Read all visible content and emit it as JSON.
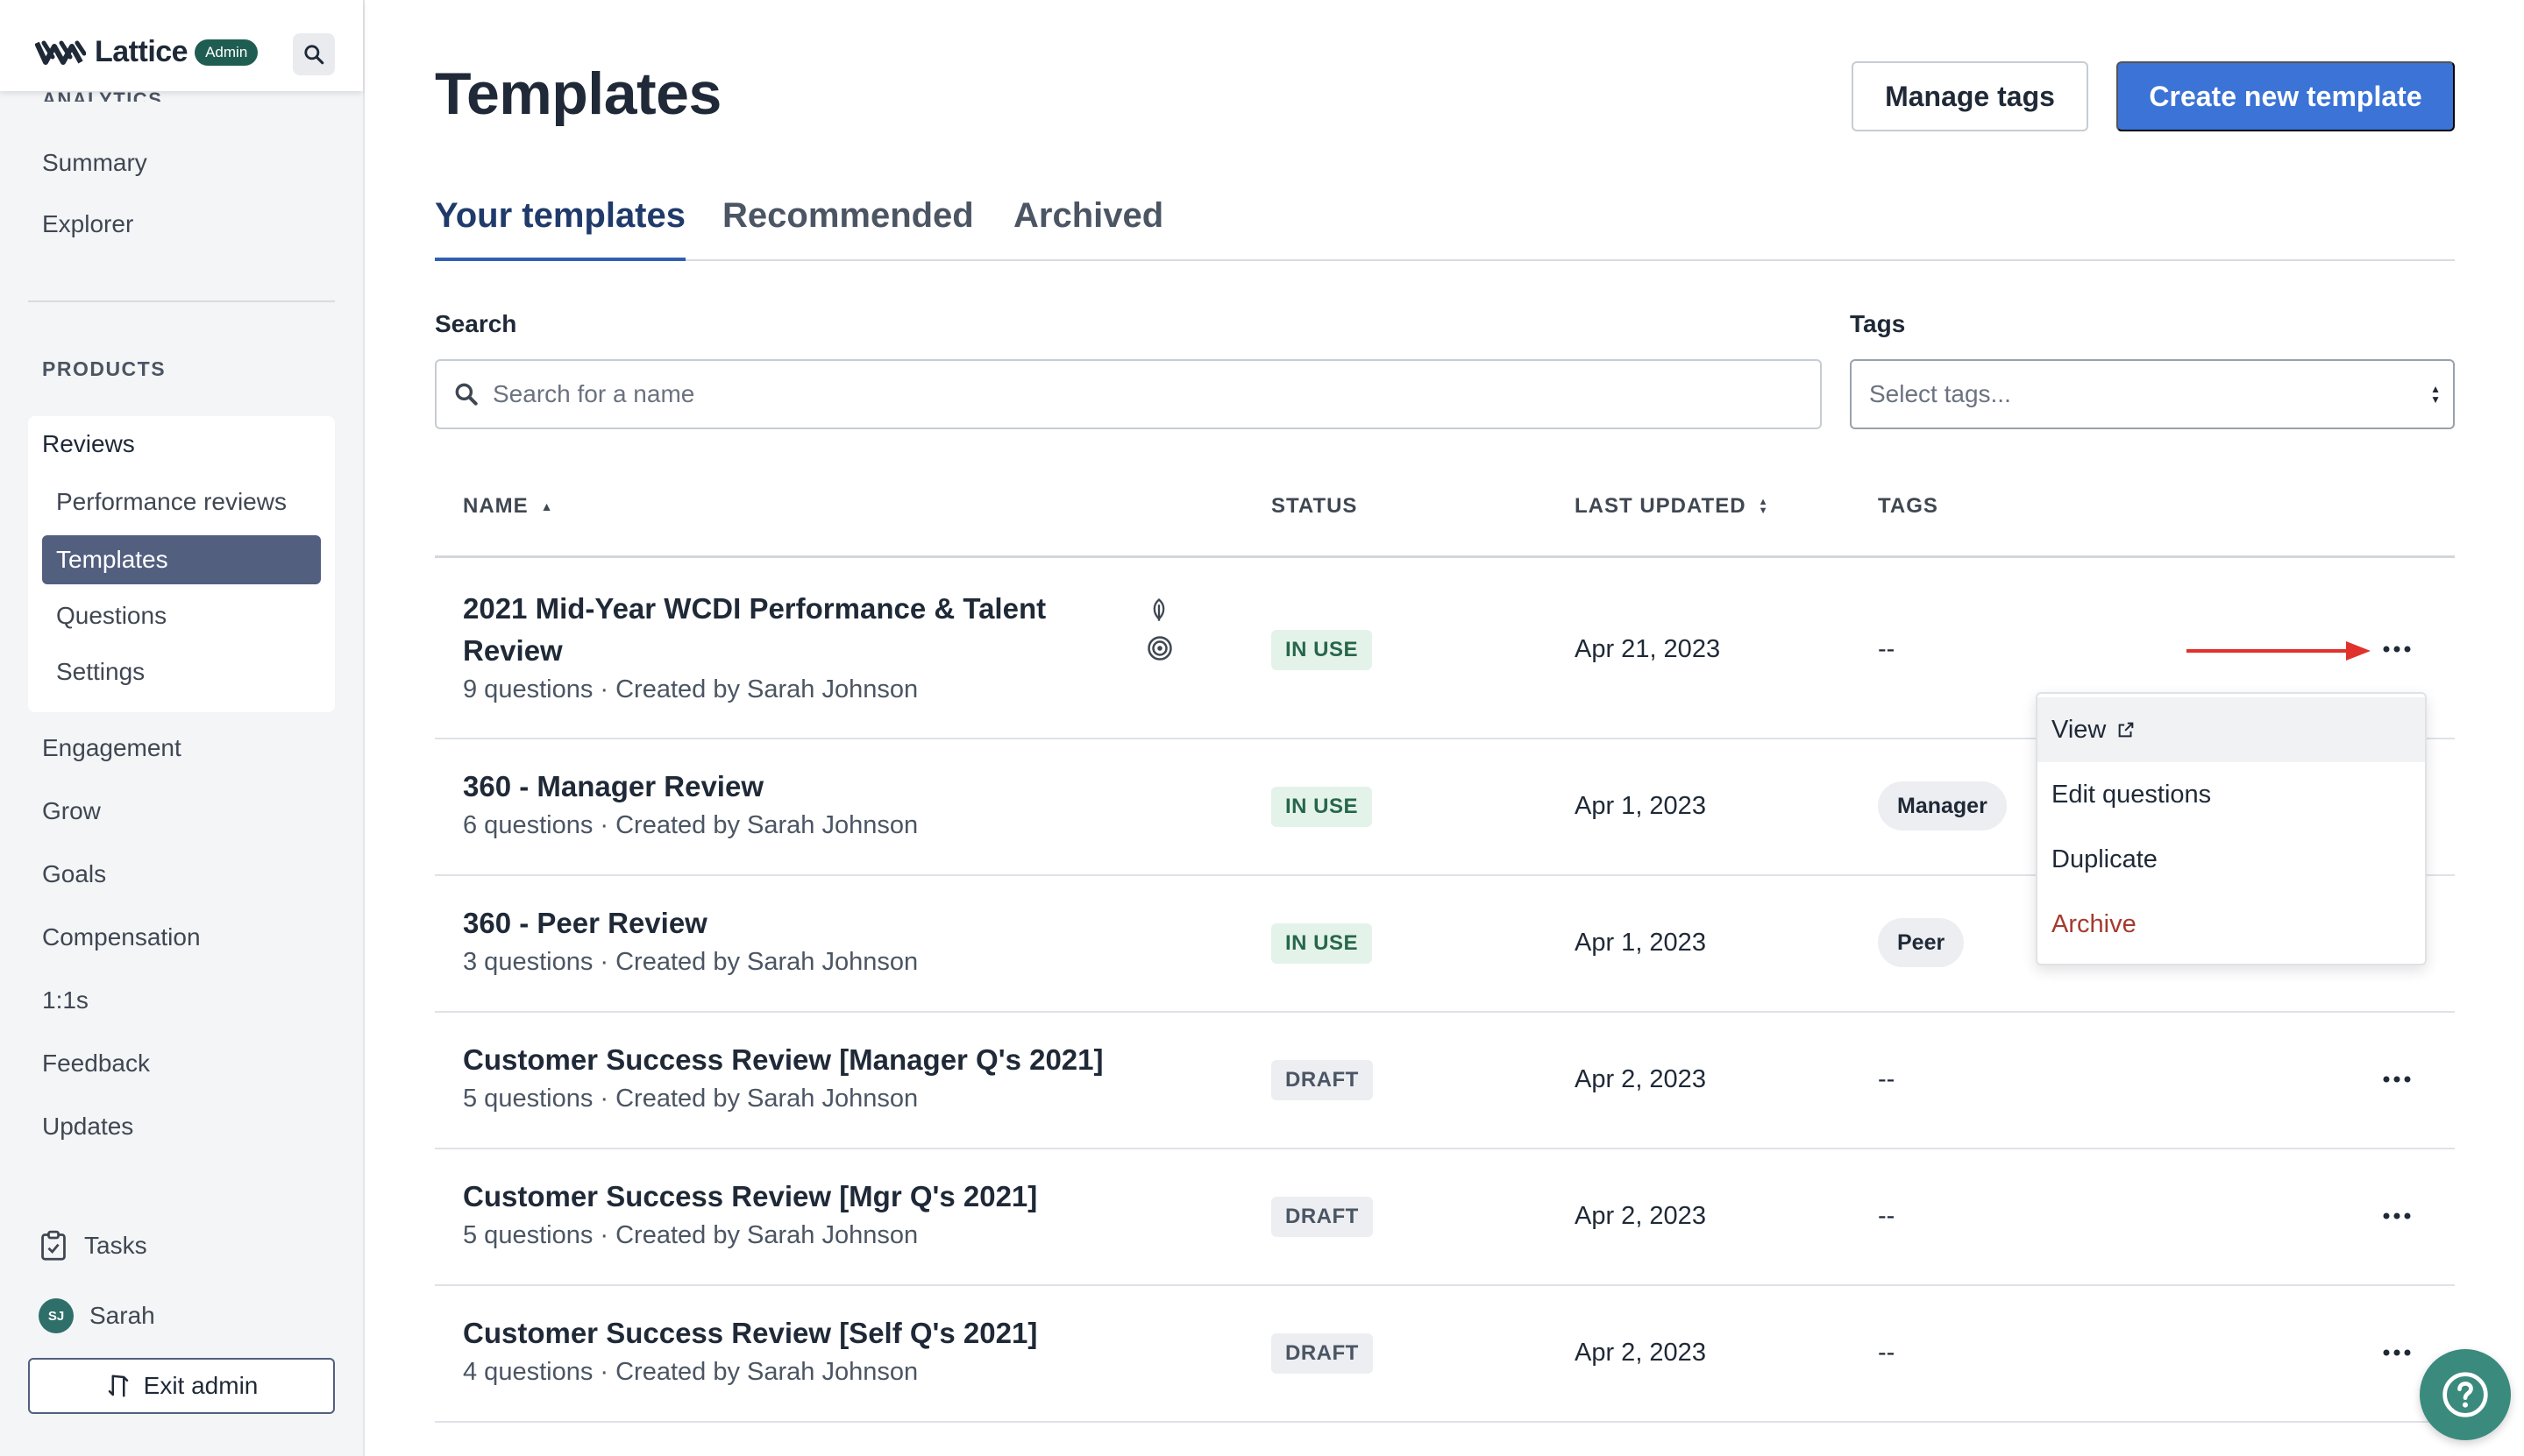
{
  "brand": {
    "name": "Lattice",
    "badge": "Admin"
  },
  "sidebar": {
    "analytics_section": "ANALYTICS",
    "analytics_links": [
      "Summary",
      "Explorer"
    ],
    "products_section": "PRODUCTS",
    "reviews": {
      "title": "Reviews",
      "items": [
        "Performance reviews",
        "Templates",
        "Questions",
        "Settings"
      ],
      "active": "Templates"
    },
    "products": [
      "Engagement",
      "Grow",
      "Goals",
      "Compensation",
      "1:1s",
      "Feedback",
      "Updates"
    ],
    "tasks_label": "Tasks",
    "user": {
      "initials": "SJ",
      "name": "Sarah"
    },
    "exit_label": "Exit admin"
  },
  "header": {
    "title": "Templates",
    "manage_tags": "Manage tags",
    "create_template": "Create new template"
  },
  "tabs": [
    "Your templates",
    "Recommended",
    "Archived"
  ],
  "filters": {
    "search_label": "Search",
    "search_placeholder": "Search for a name",
    "tags_label": "Tags",
    "tags_placeholder": "Select tags..."
  },
  "table": {
    "columns": {
      "name": "NAME",
      "status": "STATUS",
      "updated": "LAST UPDATED",
      "tags": "TAGS"
    },
    "rows": [
      {
        "name_line1": "2021 Mid-Year WCDI Performance & Talent",
        "name_line2": "Review",
        "sub": "9 questions · Created by Sarah Johnson",
        "status": "IN USE",
        "updated": "Apr 21, 2023",
        "tags": "--"
      },
      {
        "name_line1": "360 - Manager Review",
        "sub": "6 questions · Created by Sarah Johnson",
        "status": "IN USE",
        "updated": "Apr 1, 2023",
        "tags": "Manager"
      },
      {
        "name_line1": "360 - Peer Review",
        "sub": "3 questions · Created by Sarah Johnson",
        "status": "IN USE",
        "updated": "Apr 1, 2023",
        "tags": "Peer"
      },
      {
        "name_line1": "Customer Success Review [Manager Q's 2021]",
        "sub": "5 questions · Created by Sarah Johnson",
        "status": "DRAFT",
        "updated": "Apr 2, 2023",
        "tags": "--"
      },
      {
        "name_line1": "Customer Success Review [Mgr Q's 2021]",
        "sub": "5 questions · Created by Sarah Johnson",
        "status": "DRAFT",
        "updated": "Apr 2, 2023",
        "tags": "--"
      },
      {
        "name_line1": "Customer Success Review [Self Q's 2021]",
        "sub": "4 questions · Created by Sarah Johnson",
        "status": "DRAFT",
        "updated": "Apr 2, 2023",
        "tags": "--"
      }
    ]
  },
  "row_menu": {
    "items": [
      "View",
      "Edit questions",
      "Duplicate",
      "Archive"
    ]
  },
  "colors": {
    "primary": "#3b73d6",
    "sidebar_active": "#525f7f",
    "in_use": "#276749",
    "danger": "#a63a2e",
    "help": "#3b8a7e"
  }
}
